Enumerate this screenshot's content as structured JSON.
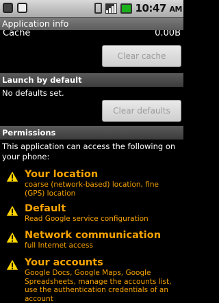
{
  "status_bar": {
    "time": "10:47",
    "time_suffix": "AM",
    "battery_level": "",
    "icons": [
      "usb-debug-icon",
      "notification-box-icon",
      "phone-icon",
      "signal-icon",
      "battery-icon"
    ]
  },
  "title_bar": {
    "title": "Application info"
  },
  "storage": {
    "cache_label": "Cache",
    "cache_value": "0.00B",
    "clear_cache_button": "Clear cache"
  },
  "launch_by_default": {
    "header": "Launch by default",
    "message": "No defaults set.",
    "clear_defaults_button": "Clear defaults"
  },
  "permissions": {
    "header": "Permissions",
    "intro": "This application can access the following on your phone:",
    "items": [
      {
        "title": "Your location",
        "detail": "coarse (network-based) location, fine (GPS) location",
        "icon": "warning-icon"
      },
      {
        "title": "Default",
        "detail": "Read Google service configuration",
        "icon": "warning-icon"
      },
      {
        "title": "Network communication",
        "detail": "full Internet access",
        "icon": "warning-icon"
      },
      {
        "title": "Your accounts",
        "detail": "Google Docs, Google Maps, Google Spreadsheets, manage the accounts list, use the authentication credentials of an account",
        "icon": "warning-icon"
      }
    ]
  },
  "colors": {
    "permission_text": "#f7a300",
    "status_bar_bg": "#c4c4c4",
    "section_header_bg": "#4a4a4a",
    "button_text_disabled": "#9b9b9b"
  }
}
